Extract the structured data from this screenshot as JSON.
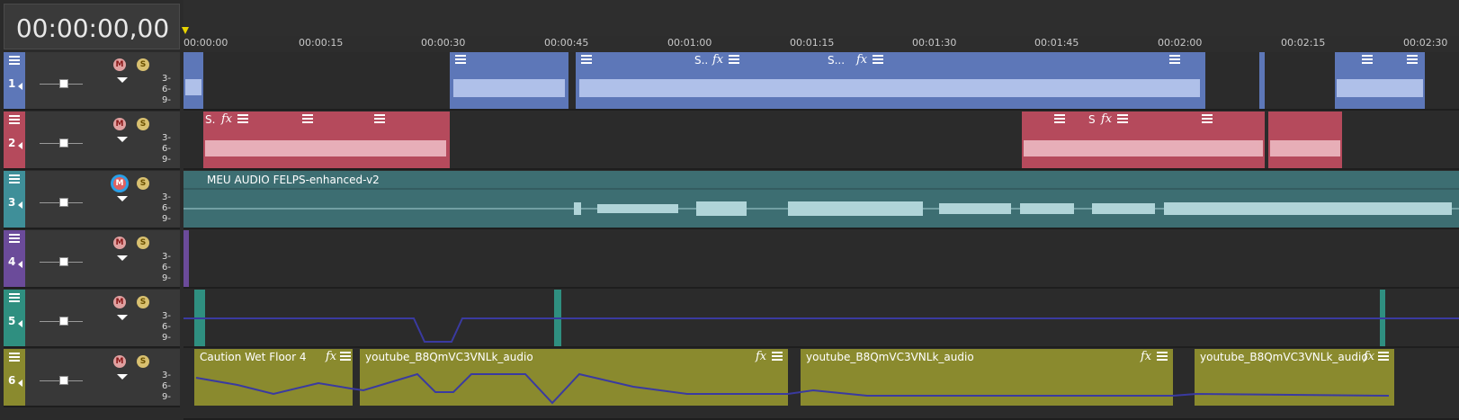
{
  "timecode": "00:00:00,00",
  "ruler": {
    "labels": [
      "00:00:00",
      "00:00:15",
      "00:00:30",
      "00:00:45",
      "00:01:00",
      "00:01:15",
      "00:01:30",
      "00:01:45",
      "00:02:00",
      "00:02:15",
      "00:02:30"
    ]
  },
  "scale_labels": [
    "3-",
    "6-",
    "9-"
  ],
  "tracks": [
    {
      "number": "1",
      "color": "#5d77b8",
      "mute_label": "M",
      "solo_label": "S",
      "mute_active": false
    },
    {
      "number": "2",
      "color": "#b54a5c",
      "mute_label": "M",
      "solo_label": "S",
      "mute_active": false
    },
    {
      "number": "3",
      "color": "#3f8f99",
      "mute_label": "M",
      "solo_label": "S",
      "mute_active": true
    },
    {
      "number": "4",
      "color": "#6b4b9a",
      "mute_label": "M",
      "solo_label": "S",
      "mute_active": false
    },
    {
      "number": "5",
      "color": "#2f8f80",
      "mute_label": "M",
      "solo_label": "S",
      "mute_active": false
    },
    {
      "number": "6",
      "color": "#8a8a2e",
      "mute_label": "M",
      "solo_label": "S",
      "mute_active": false
    }
  ],
  "clips": {
    "track1_label_a": "S..",
    "track1_label_b": "S...",
    "track2_label_a": "S.",
    "track2_label_b": "S",
    "track3_title": "MEU AUDIO FELPS-enhanced-v2",
    "track6_title_1": "Caution Wet Floor 4",
    "track6_title_2": "youtube_B8QmVC3VNLk_audio",
    "track6_title_3": "youtube_B8QmVC3VNLk_audio",
    "track6_title_4": "youtube_B8QmVC3VNLk_audio",
    "fx_label": "fx"
  },
  "icons": {
    "menu": "hamburger-icon",
    "speaker": "speaker-icon",
    "mute": "mute-icon",
    "solo": "solo-icon",
    "dropdown": "chevron-down-icon",
    "fx": "fx-icon"
  }
}
